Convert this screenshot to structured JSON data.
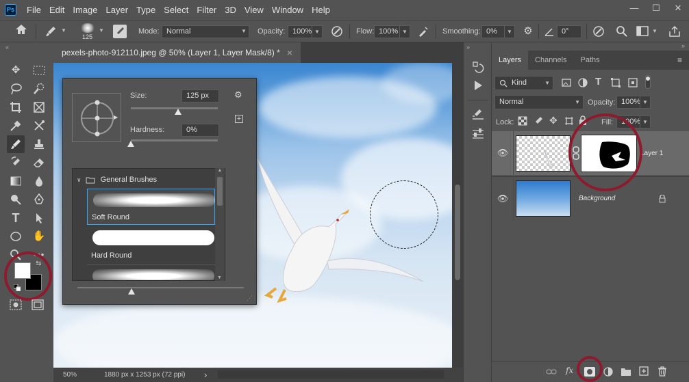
{
  "app": {
    "logo": "Ps"
  },
  "menu": [
    "File",
    "Edit",
    "Image",
    "Layer",
    "Type",
    "Select",
    "Filter",
    "3D",
    "View",
    "Window",
    "Help"
  ],
  "window_controls": {
    "minimize": "—",
    "maximize": "☐",
    "close": "✕"
  },
  "options": {
    "brush_size": "125",
    "mode_label": "Mode:",
    "mode_value": "Normal",
    "opacity_label": "Opacity:",
    "opacity_value": "100%",
    "flow_label": "Flow:",
    "flow_value": "100%",
    "smoothing_label": "Smoothing:",
    "smoothing_value": "0%",
    "angle_value": "0°"
  },
  "document": {
    "tab_title": "pexels-photo-912110.jpeg @ 50% (Layer 1, Layer Mask/8) *",
    "tab_close": "×"
  },
  "status": {
    "zoom": "50%",
    "info": "1880 px x 1253 px (72 ppi)",
    "arrow": "›"
  },
  "brush_picker": {
    "size_label": "Size:",
    "size_value": "125 px",
    "hardness_label": "Hardness:",
    "hardness_value": "0%",
    "size_fraction": 0.54,
    "hardness_fraction": 0.0,
    "folder_name": "General Brushes",
    "brushes": [
      {
        "name": "Soft Round",
        "selected": true
      },
      {
        "name": "Hard Round",
        "selected": false
      }
    ]
  },
  "layers_panel": {
    "tabs": [
      "Layers",
      "Channels",
      "Paths"
    ],
    "filter_kind": "Kind",
    "blend_mode": "Normal",
    "opacity_label": "Opacity:",
    "opacity_value": "100%",
    "lock_label": "Lock:",
    "fill_label": "Fill:",
    "fill_value": "100%",
    "layers": [
      {
        "name": "Layer 1",
        "visible": true,
        "has_mask": true
      },
      {
        "name": "Background",
        "visible": true,
        "locked": true
      }
    ]
  },
  "colors": {
    "accent": "#31a8ff",
    "highlight_ring": "#8e1a2e",
    "foreground": "#ffffff",
    "background": "#000000"
  }
}
